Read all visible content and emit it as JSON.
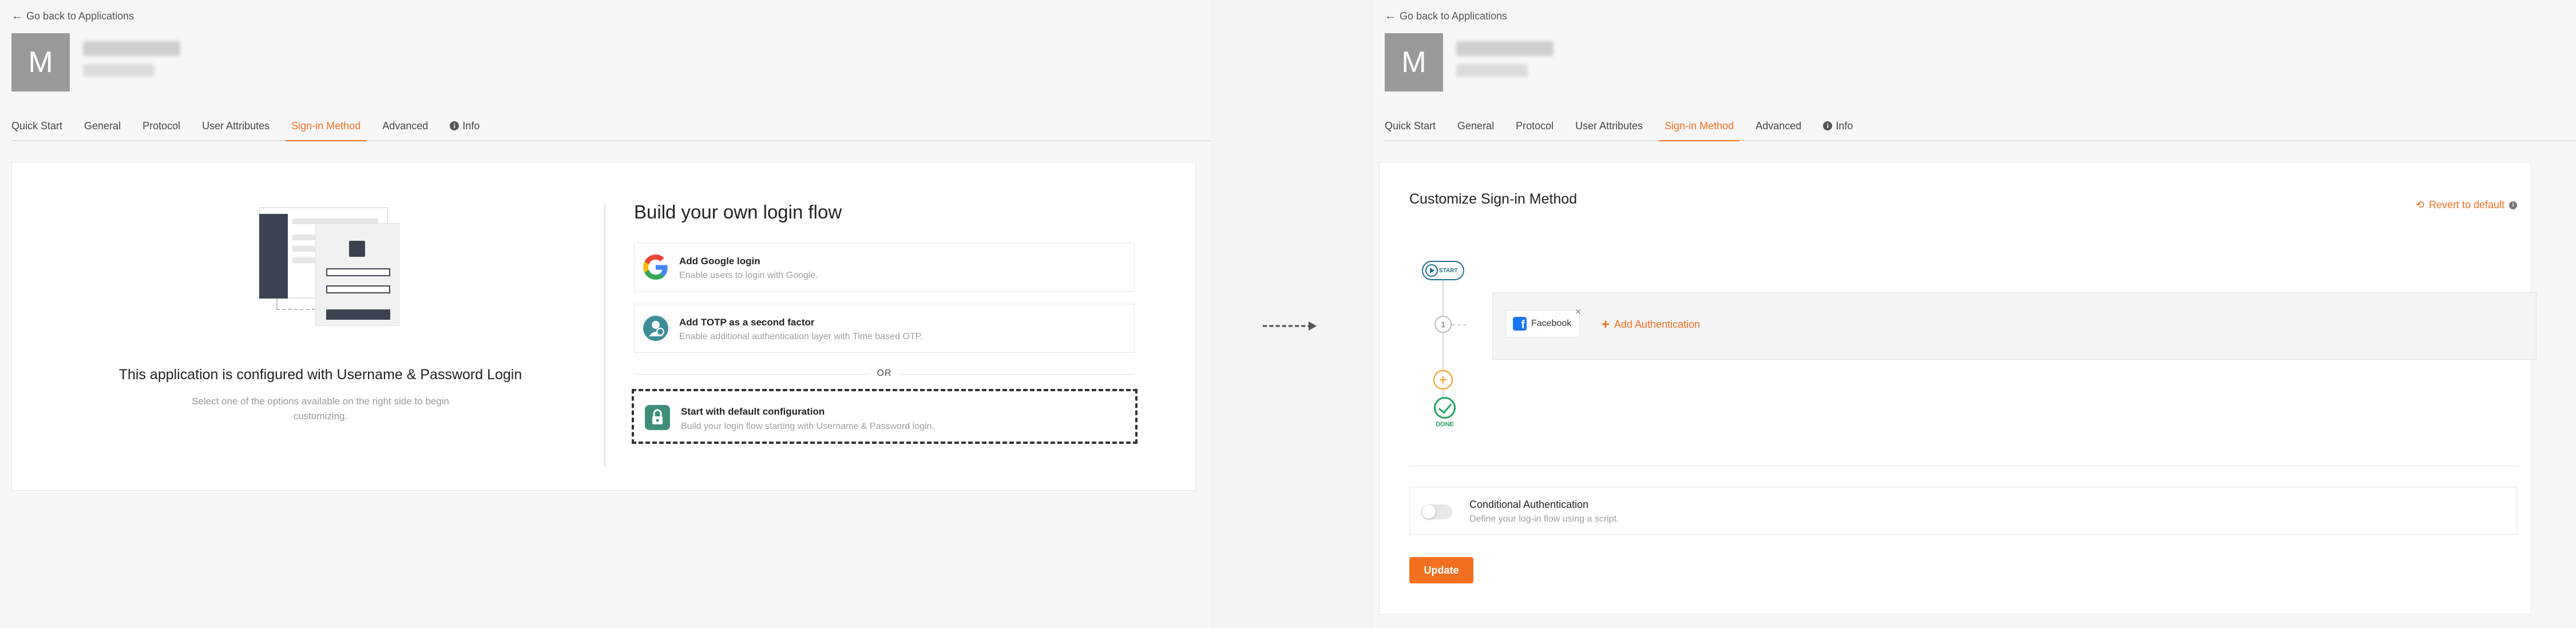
{
  "left": {
    "back_link": "Go back to Applications",
    "app_avatar_letter": "M",
    "tabs": [
      {
        "label": "Quick Start"
      },
      {
        "label": "General"
      },
      {
        "label": "Protocol"
      },
      {
        "label": "User Attributes"
      },
      {
        "label": "Sign-in Method",
        "active": true
      },
      {
        "label": "Advanced"
      },
      {
        "label": "Info",
        "icon": "info-icon"
      }
    ],
    "configured_title": "This application is configured with Username & Password Login",
    "configured_desc_1": "Select one of the options available on the right side to begin",
    "configured_desc_2": "customizing.",
    "flow_title": "Build your own login flow",
    "options": {
      "google": {
        "title": "Add Google login",
        "desc": "Enable users to login with Google.",
        "icon": "google-icon"
      },
      "totp": {
        "title": "Add TOTP as a second factor",
        "desc": "Enable additional authentication layer with Time based OTP.",
        "icon": "totp-icon"
      },
      "default": {
        "title": "Start with default configuration",
        "desc": "Build your login flow starting with Username & Password login.",
        "icon": "lock-icon"
      }
    },
    "or_label": "OR"
  },
  "right": {
    "back_link": "Go back to Applications",
    "app_avatar_letter": "M",
    "tabs": [
      {
        "label": "Quick Start"
      },
      {
        "label": "General"
      },
      {
        "label": "Protocol"
      },
      {
        "label": "User Attributes"
      },
      {
        "label": "Sign-in Method",
        "active": true
      },
      {
        "label": "Advanced"
      },
      {
        "label": "Info",
        "icon": "info-icon"
      }
    ],
    "customize_title": "Customize Sign-in Method",
    "revert_label": "Revert to default",
    "start_label": "START",
    "step_number": "1",
    "authenticator_chip": "Facebook",
    "add_authentication": "Add Authentication",
    "done_label": "DONE",
    "conditional_title": "Conditional Authentication",
    "conditional_desc": "Define your log-in flow using a script.",
    "conditional_enabled": false,
    "update_button": "Update"
  },
  "colors": {
    "accent": "#f37021",
    "done": "#21a366",
    "start": "#1f6f8b",
    "facebook": "#1877f2"
  }
}
